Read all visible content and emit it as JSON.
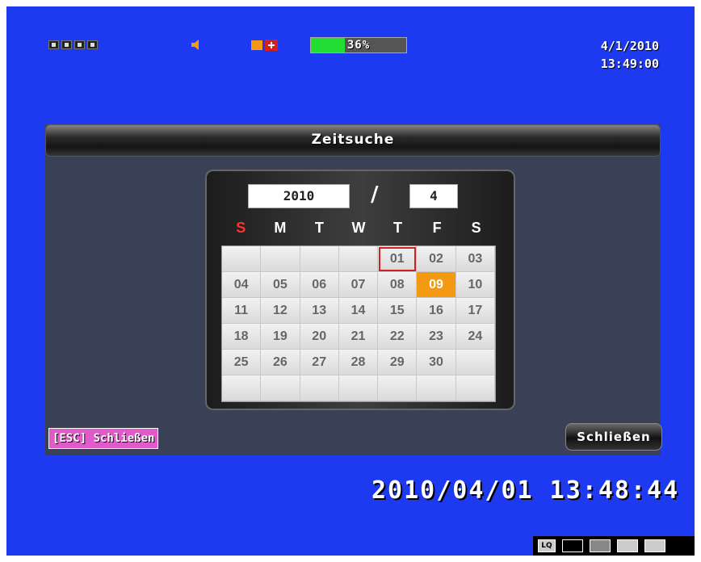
{
  "status": {
    "hdd_percent_label": "36%",
    "hdd_fill_fraction": 0.36,
    "date": "4/1/2010",
    "time": "13:49:00"
  },
  "dialog": {
    "title": "Zeitsuche",
    "year": "2010",
    "separator": "/",
    "month": "4",
    "weekdays": [
      "S",
      "M",
      "T",
      "W",
      "T",
      "F",
      "S"
    ],
    "days": [
      "",
      "",
      "",
      "",
      "01",
      "02",
      "03",
      "04",
      "05",
      "06",
      "07",
      "08",
      "09",
      "10",
      "11",
      "12",
      "13",
      "14",
      "15",
      "16",
      "17",
      "18",
      "19",
      "20",
      "21",
      "22",
      "23",
      "24",
      "25",
      "26",
      "27",
      "28",
      "29",
      "30",
      "",
      "",
      "",
      "",
      "",
      "",
      "",
      ""
    ],
    "today_index": 4,
    "selected_index": 12,
    "esc_hint": "[ESC] Schließen",
    "close_label": "Schließen"
  },
  "footer": {
    "timestamp": "2010/04/01  13:48:44",
    "toolbar_lq": "LQ"
  },
  "colors": {
    "background": "#1e3af0",
    "selected": "#f39a12",
    "today_border": "#d02020",
    "sunday": "#ff3030",
    "esc_hint_bg": "#e05bc9",
    "hdd_fill": "#22dd33"
  }
}
